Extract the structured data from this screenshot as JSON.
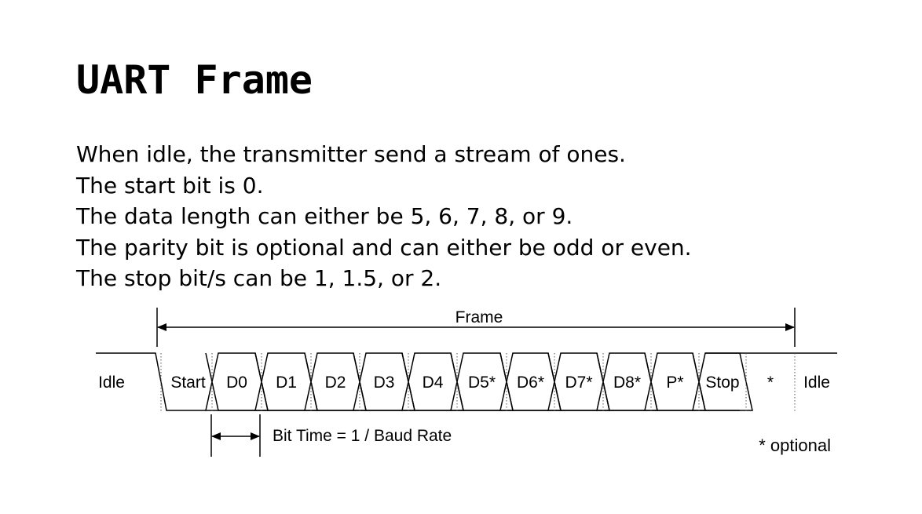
{
  "title": "UART Frame",
  "lines": [
    "When idle, the transmitter send a stream of ones.",
    "The start bit is 0.",
    "The data length can either be 5, 6, 7, 8, or 9.",
    "The parity bit is optional and can either be odd or even.",
    "The stop bit/s can be 1, 1.5, or 2."
  ],
  "diagram": {
    "frame_label": "Frame",
    "idle_left": "Idle",
    "idle_right": "Idle",
    "bits": [
      "Start",
      "D0",
      "D1",
      "D2",
      "D3",
      "D4",
      "D5*",
      "D6*",
      "D7*",
      "D8*",
      "P*",
      "Stop",
      "*"
    ],
    "bit_time_label": "Bit Time = 1 / Baud Rate",
    "optional_note": "* optional"
  }
}
